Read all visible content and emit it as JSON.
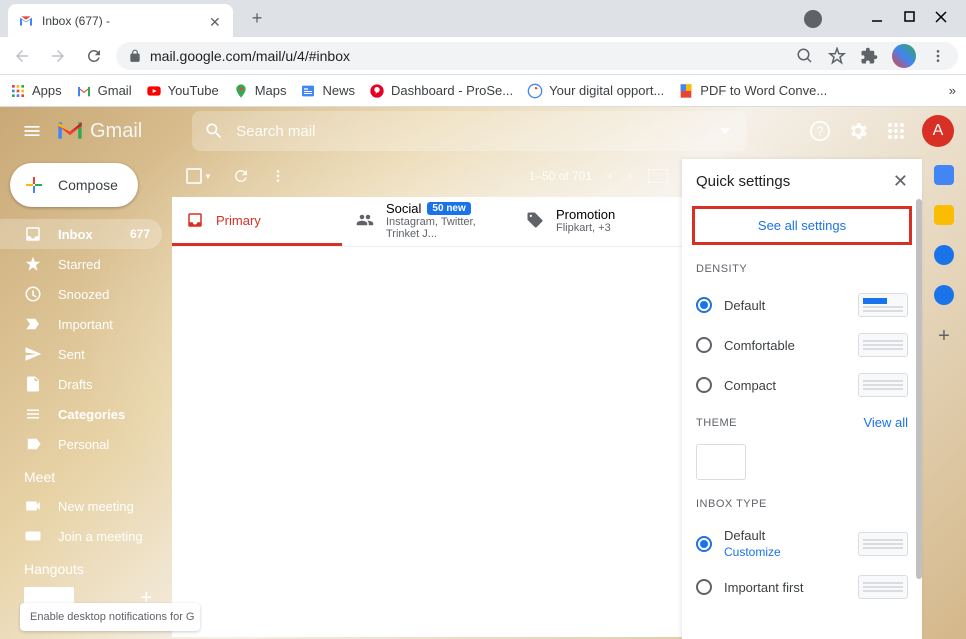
{
  "browser": {
    "tab_title": "Inbox (677) -",
    "url_display": "mail.google.com/mail/u/4/#inbox",
    "bookmarks": [
      {
        "icon": "apps",
        "label": "Apps"
      },
      {
        "icon": "gmail",
        "label": "Gmail"
      },
      {
        "icon": "youtube",
        "label": "YouTube"
      },
      {
        "icon": "maps",
        "label": "Maps"
      },
      {
        "icon": "news",
        "label": "News"
      },
      {
        "icon": "pinterest",
        "label": "Dashboard - ProSe..."
      },
      {
        "icon": "google",
        "label": "Your digital opport..."
      },
      {
        "icon": "pdf",
        "label": "PDF to Word Conve..."
      }
    ]
  },
  "gmail": {
    "logo_text": "Gmail",
    "search_placeholder": "Search mail",
    "avatar_letter": "A",
    "compose_label": "Compose",
    "nav": [
      {
        "icon": "inbox",
        "label": "Inbox",
        "count": "677",
        "active": true,
        "bold": true
      },
      {
        "icon": "star",
        "label": "Starred"
      },
      {
        "icon": "clock",
        "label": "Snoozed"
      },
      {
        "icon": "important",
        "label": "Important"
      },
      {
        "icon": "send",
        "label": "Sent"
      },
      {
        "icon": "draft",
        "label": "Drafts"
      },
      {
        "icon": "categories",
        "label": "Categories",
        "bold": true
      },
      {
        "icon": "label",
        "label": "Personal"
      }
    ],
    "meet_label": "Meet",
    "meet_items": [
      {
        "icon": "video",
        "label": "New meeting"
      },
      {
        "icon": "keyboard",
        "label": "Join a meeting"
      }
    ],
    "hangouts_label": "Hangouts",
    "notification_text": "Enable desktop notifications for G",
    "pagination_text": "1–50 of 701",
    "tabs": [
      {
        "icon": "inbox-tab",
        "label": "Primary",
        "active": true
      },
      {
        "icon": "social",
        "label": "Social",
        "badge": "50 new",
        "sub": "Instagram, Twitter, Trinket J..."
      },
      {
        "icon": "tag",
        "label": "Promotion",
        "sub": "Flipkart, +3"
      }
    ]
  },
  "settings": {
    "title": "Quick settings",
    "see_all": "See all settings",
    "density_label": "DENSITY",
    "density_options": [
      {
        "label": "Default",
        "checked": true
      },
      {
        "label": "Comfortable"
      },
      {
        "label": "Compact"
      }
    ],
    "theme_label": "THEME",
    "view_all": "View all",
    "inbox_type_label": "INBOX TYPE",
    "inbox_options": [
      {
        "label": "Default",
        "customize": "Customize",
        "checked": true
      },
      {
        "label": "Important first"
      }
    ]
  }
}
